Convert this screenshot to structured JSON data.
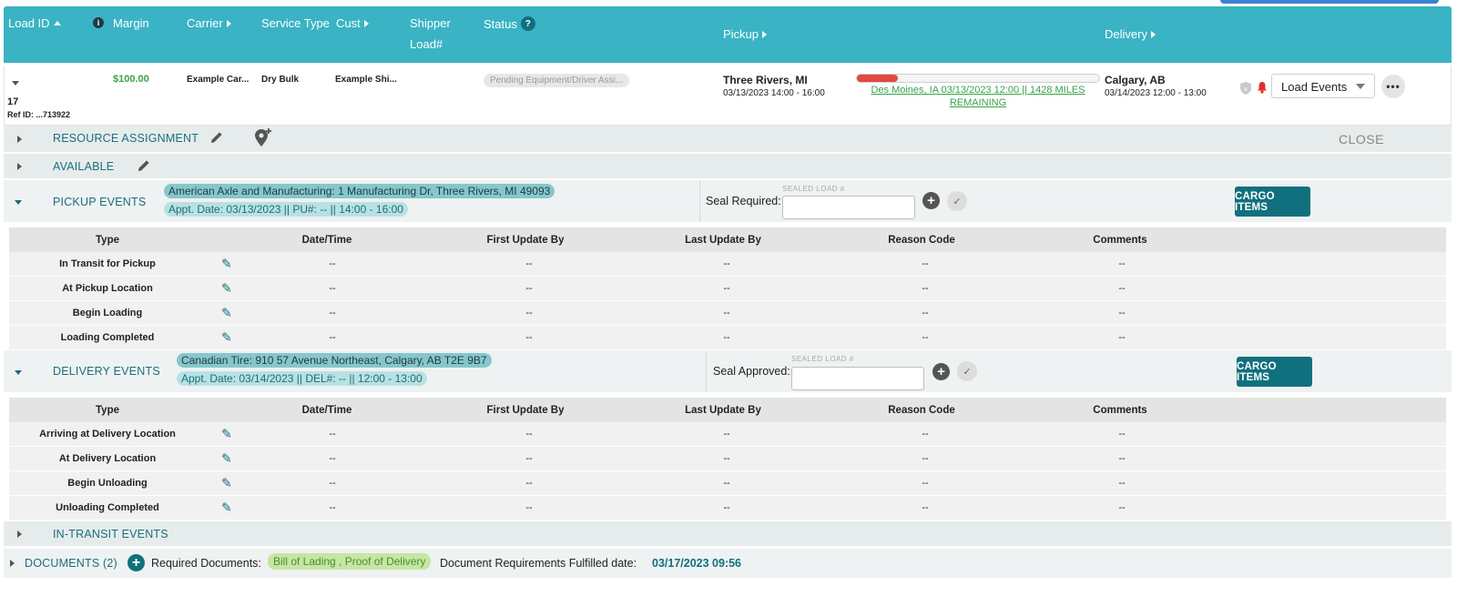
{
  "header": {
    "load_id": "Load ID",
    "info": "i",
    "margin": "Margin",
    "carrier": "Carrier",
    "service_type": "Service Type",
    "cust": "Cust",
    "shipper": "Shipper",
    "shipper_load": "Load#",
    "status": "Status",
    "status_help": "?",
    "pickup": "Pickup",
    "delivery": "Delivery"
  },
  "load": {
    "id": "17",
    "ref_id": "Ref ID: ...713922",
    "margin": "$100.00",
    "carrier": "Example Car...",
    "service_type": "Dry Bulk",
    "cust": "Example Shi...",
    "status": "Pending Equipment/Driver Assi...",
    "pickup_city": "Three Rivers, MI",
    "pickup_time": "03/13/2023 14:00 - 16:00",
    "progress_fraction": 0.17,
    "progress_line1": "Des Moines, IA 03/13/2023 12:00 || 1428 MILES",
    "progress_line2": "REMAINING",
    "delivery_city": "Calgary, AB",
    "delivery_time": "03/14/2023 12:00 - 13:00",
    "events_select": "Load Events",
    "more": "•••"
  },
  "sections": {
    "resource": "RESOURCE ASSIGNMENT",
    "close": "CLOSE",
    "available": "AVAILABLE",
    "pickup": "PICKUP EVENTS",
    "delivery": "DELIVERY EVENTS",
    "in_transit": "IN-TRANSIT EVENTS"
  },
  "pickup": {
    "address": "American Axle and Manufacturing: 1 Manufacturing Dr, Three Rivers, MI 49093",
    "appt": "Appt. Date: 03/13/2023 || PU#: -- || 14:00 - 16:00",
    "seal_label": "Seal Required:",
    "sealed_label": "SEALED LOAD #",
    "cargo": "CARGO ITEMS"
  },
  "delivery": {
    "address": "Canadian Tire: 910 57 Avenue Northeast, Calgary, AB T2E 9B7",
    "appt": "Appt. Date: 03/14/2023 || DEL#: -- || 12:00 - 13:00",
    "seal_label": "Seal Approved:",
    "sealed_label": "SEALED LOAD #",
    "cargo": "CARGO ITEMS"
  },
  "table_headers": {
    "type": "Type",
    "datetime": "Date/Time",
    "first": "First Update By",
    "last": "Last Update By",
    "reason": "Reason Code",
    "comments": "Comments"
  },
  "pickup_rows": [
    {
      "type": "In Transit for Pickup",
      "datetime": "--",
      "first": "--",
      "last": "--",
      "reason": "--",
      "comments": "--"
    },
    {
      "type": "At Pickup Location",
      "datetime": "--",
      "first": "--",
      "last": "--",
      "reason": "--",
      "comments": "--"
    },
    {
      "type": "Begin Loading",
      "datetime": "--",
      "first": "--",
      "last": "--",
      "reason": "--",
      "comments": "--"
    },
    {
      "type": "Loading Completed",
      "datetime": "--",
      "first": "--",
      "last": "--",
      "reason": "--",
      "comments": "--"
    }
  ],
  "delivery_rows": [
    {
      "type": "Arriving at Delivery Location",
      "datetime": "--",
      "first": "--",
      "last": "--",
      "reason": "--",
      "comments": "--"
    },
    {
      "type": "At Delivery Location",
      "datetime": "--",
      "first": "--",
      "last": "--",
      "reason": "--",
      "comments": "--"
    },
    {
      "type": "Begin Unloading",
      "datetime": "--",
      "first": "--",
      "last": "--",
      "reason": "--",
      "comments": "--"
    },
    {
      "type": "Unloading Completed",
      "datetime": "--",
      "first": "--",
      "last": "--",
      "reason": "--",
      "comments": "--"
    }
  ],
  "documents": {
    "label": "DOCUMENTS (2)",
    "required_label": "Required Documents:",
    "required_value": "Bill of Lading , Proof of Delivery",
    "fulfilled_label": "Document Requirements Fulfilled date:",
    "fulfilled_value": "03/17/2023 09:56"
  },
  "icons": {
    "pencil": "✎",
    "check": "✓",
    "plus": "+"
  },
  "colors": {
    "header_bg": "#3ab3c4",
    "accent": "#11707e",
    "margin_green": "#3aa14a",
    "progress_red": "#e04a3f"
  }
}
